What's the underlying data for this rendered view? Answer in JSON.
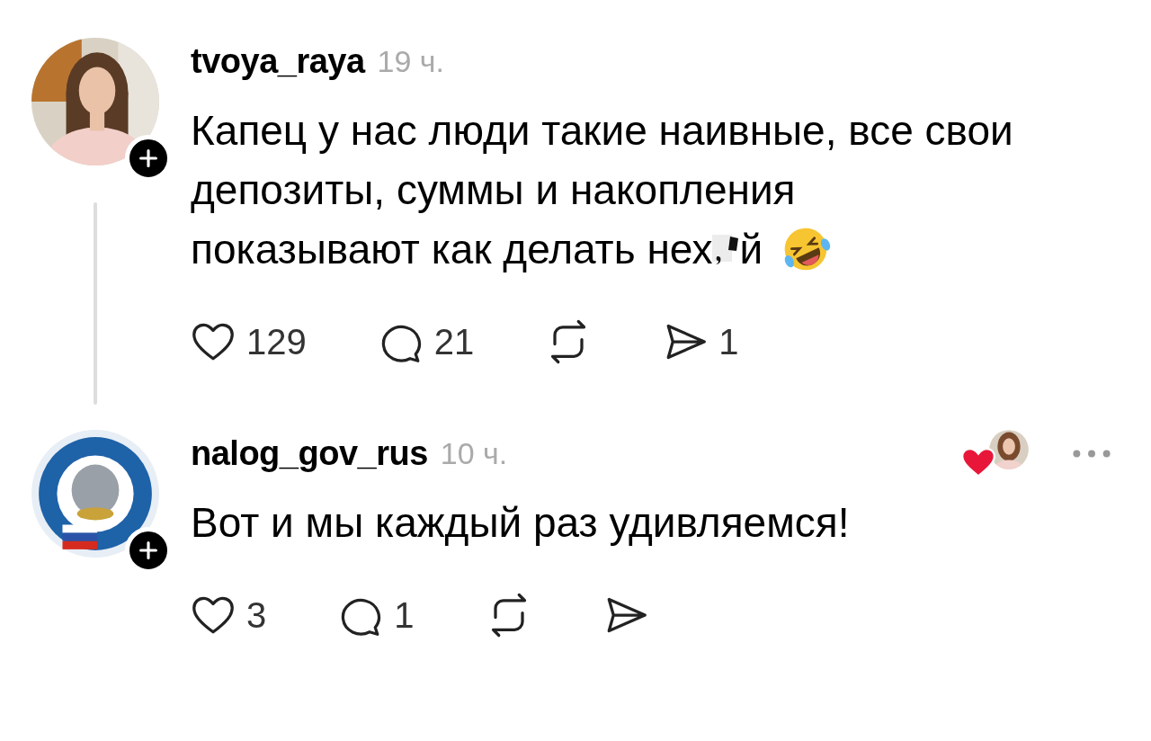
{
  "comments": [
    {
      "author": "tvoya_raya",
      "time": "19 ч.",
      "thread_continues": true,
      "liked_by_author": false,
      "more_menu": false,
      "body": [
        [
          {
            "kind": "text",
            "text": "Капец у нас люди такие наивные, все свои"
          }
        ],
        [
          {
            "kind": "text",
            "text": "депозиты, суммы и накопления"
          }
        ],
        [
          {
            "kind": "text",
            "text": "показывают как делать нех"
          },
          {
            "kind": "censor"
          },
          {
            "kind": "text",
            "text": "й"
          },
          {
            "kind": "emoji"
          }
        ]
      ],
      "likes": "129",
      "replies": "21",
      "shares": "1"
    },
    {
      "author": "nalog_gov_rus",
      "time": "10 ч.",
      "thread_continues": false,
      "liked_by_author": true,
      "more_menu": true,
      "body": [
        [
          {
            "kind": "text",
            "text": "Вот и мы каждый раз удивляемся!"
          }
        ]
      ],
      "likes": "3",
      "replies": "1"
    }
  ]
}
